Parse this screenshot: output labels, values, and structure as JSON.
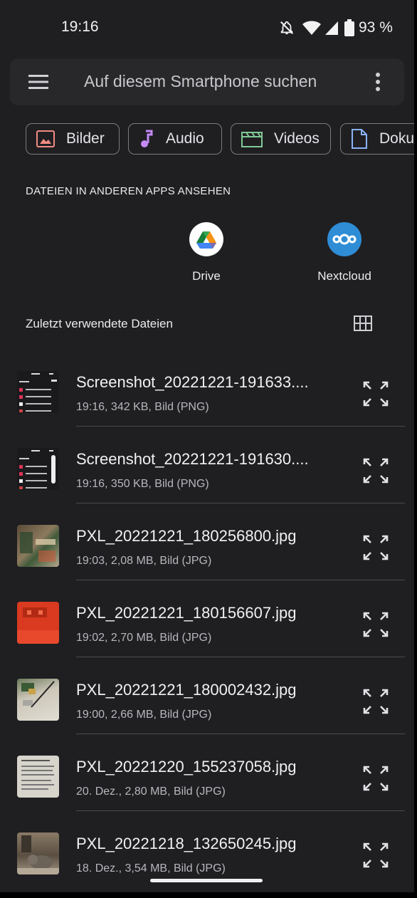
{
  "status_bar": {
    "time": "19:16",
    "battery": "93 %",
    "icons": [
      "notifications-off-icon",
      "wifi-icon",
      "cell-signal-icon",
      "battery-icon"
    ]
  },
  "search": {
    "placeholder": "Auf diesem Smartphone suchen",
    "icons": [
      "menu-icon",
      "more-vert-icon"
    ]
  },
  "categories": [
    {
      "label": "Bilder",
      "icon": "image-icon",
      "color": "#f28b82"
    },
    {
      "label": "Audio",
      "icon": "music-note-icon",
      "color": "#c58af9"
    },
    {
      "label": "Videos",
      "icon": "movie-icon",
      "color": "#81c995"
    },
    {
      "label": "Doku",
      "icon": "document-icon",
      "color": "#8ab4f8"
    }
  ],
  "other_apps": {
    "title": "DATEIEN IN ANDEREN APPS ANSEHEN",
    "apps": [
      {
        "label": "Drive",
        "icon": "google-drive-icon"
      },
      {
        "label": "Nextcloud",
        "icon": "nextcloud-icon",
        "color": "#0082c9"
      }
    ]
  },
  "recent": {
    "title": "Zuletzt verwendete Dateien",
    "view_toggle_icon": "grid-view-icon",
    "files": [
      {
        "name": "Screenshot_20221221-191633....",
        "meta": "19:16, 342 KB, Bild (PNG)"
      },
      {
        "name": "Screenshot_20221221-191630....",
        "meta": "19:16, 350 KB, Bild (PNG)"
      },
      {
        "name": "PXL_20221221_180256800.jpg",
        "meta": "19:03, 2,08 MB, Bild (JPG)"
      },
      {
        "name": "PXL_20221221_180156607.jpg",
        "meta": "19:02, 2,70 MB, Bild (JPG)"
      },
      {
        "name": "PXL_20221221_180002432.jpg",
        "meta": "19:00, 2,66 MB, Bild (JPG)"
      },
      {
        "name": "PXL_20221220_155237058.jpg",
        "meta": "20. Dez., 2,80 MB, Bild (JPG)"
      },
      {
        "name": "PXL_20221218_132650245.jpg",
        "meta": "18. Dez., 3,54 MB, Bild (JPG)"
      }
    ]
  }
}
